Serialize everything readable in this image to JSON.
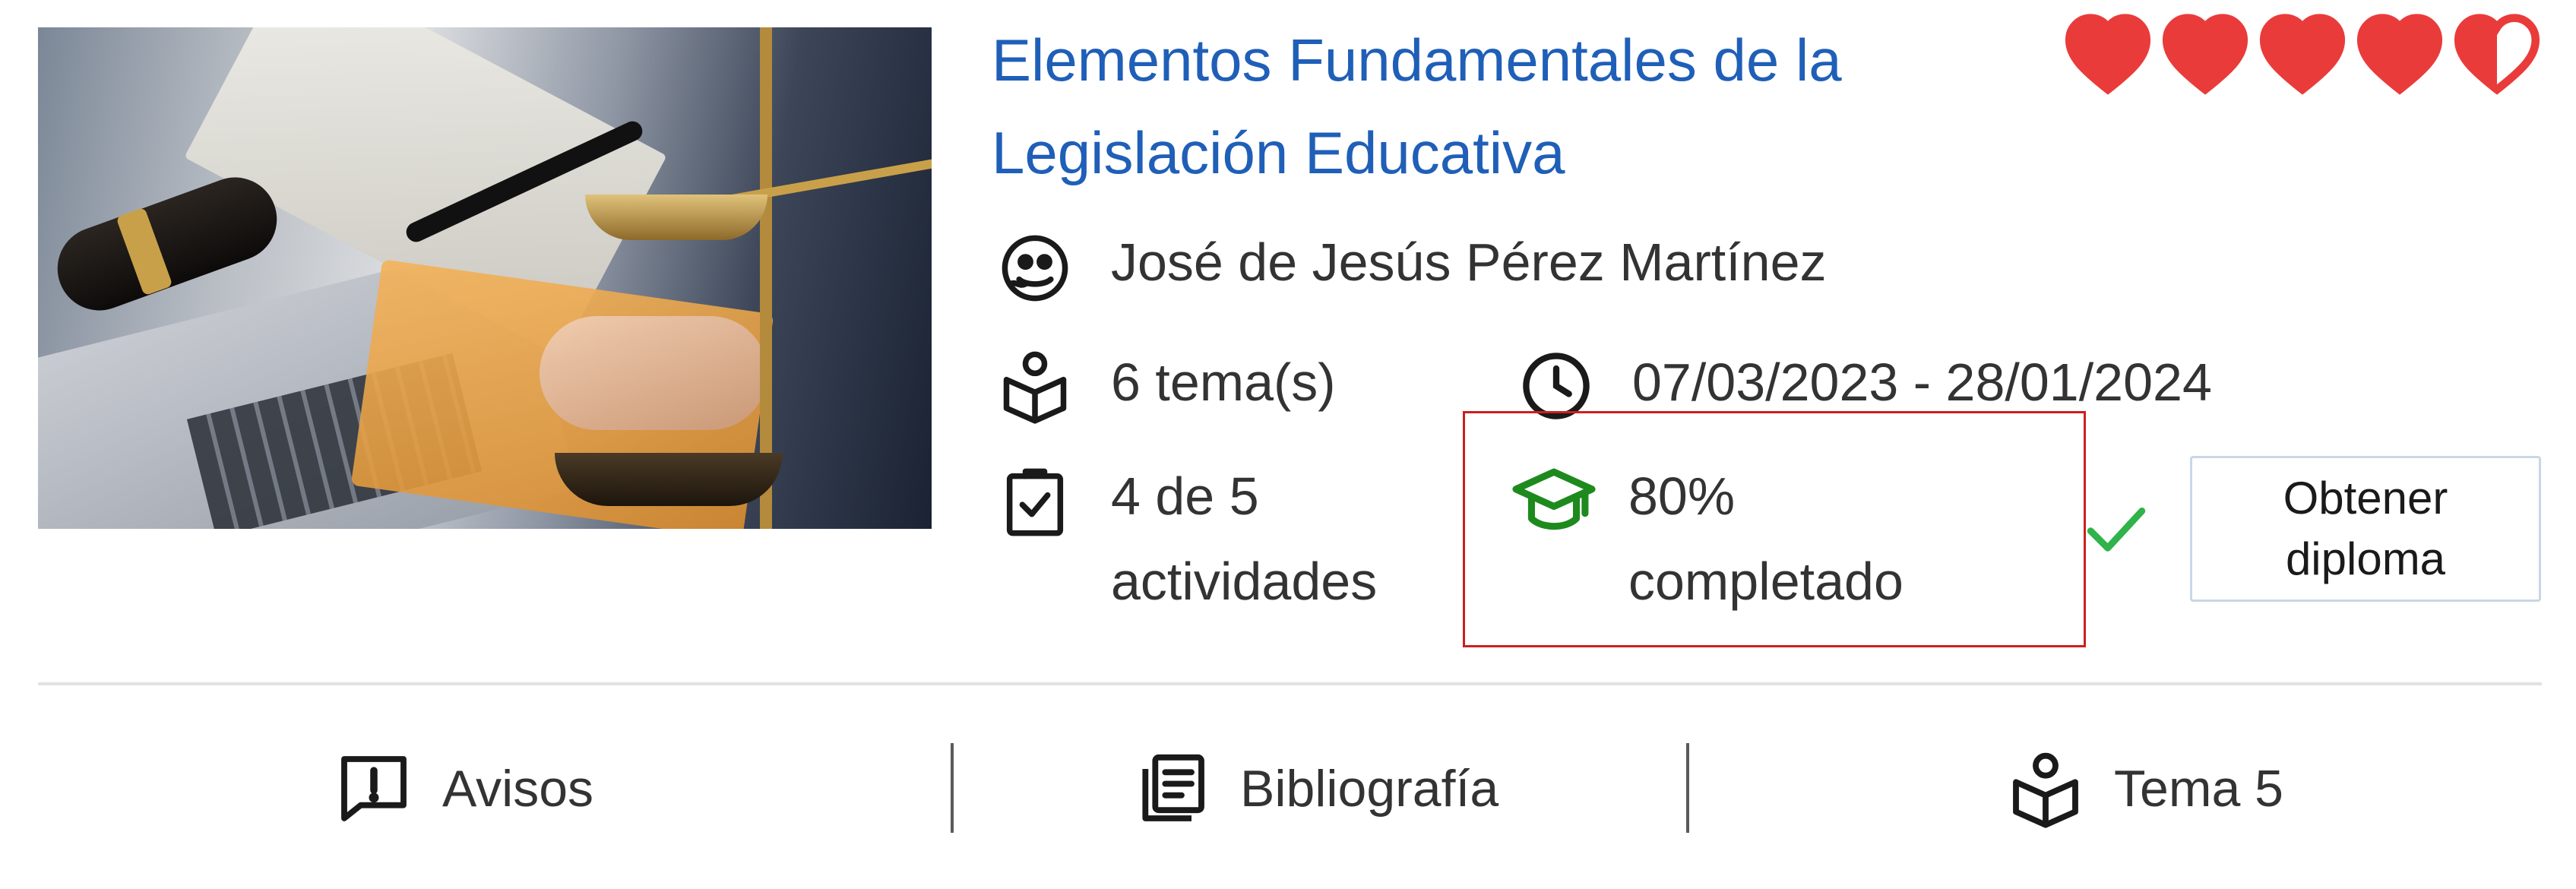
{
  "course": {
    "title_line1": "Elementos Fundamentales de la",
    "title_line2": "Legislación Educativa",
    "rating_hearts": 4.5,
    "rating_max": 5,
    "author": "José de Jesús Pérez Martínez",
    "topics": "6 tema(s)",
    "dates": "07/03/2023 - 28/01/2024",
    "activities_line1": "4 de 5",
    "activities_line2": "actividades",
    "progress_line1": "80%",
    "progress_line2": "completado",
    "progress_percent": 80,
    "diploma_button_label": "Obtener diploma"
  },
  "bottom_nav": {
    "avisos": "Avisos",
    "bibliografia": "Bibliografía",
    "tema": "Tema 5"
  },
  "icons": {
    "author": "user-face-icon",
    "topics": "book-reader-icon",
    "dates": "clock-icon",
    "activities": "clipboard-check-icon",
    "progress": "graduation-cap-icon",
    "completed": "checkmark-icon",
    "avisos": "alert-message-icon",
    "bibliografia": "library-icon",
    "tema": "book-reader-icon"
  },
  "colors": {
    "title": "#1f5fb8",
    "heart": "#ea3b3b",
    "progress_icon": "#1e8a1e",
    "check": "#2fb34a",
    "highlight_border": "#cc1f1f",
    "text": "#333333"
  }
}
